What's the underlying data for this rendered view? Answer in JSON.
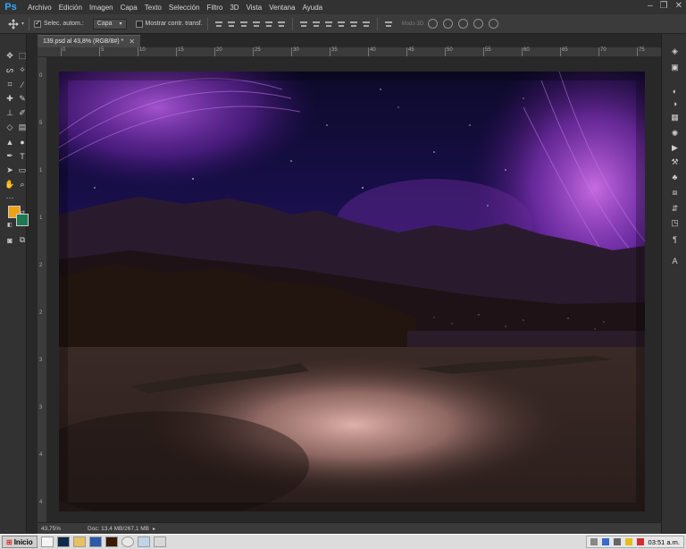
{
  "app": {
    "logo": "Ps"
  },
  "menu": [
    "Archivo",
    "Edición",
    "Imagen",
    "Capa",
    "Texto",
    "Selección",
    "Filtro",
    "3D",
    "Vista",
    "Ventana",
    "Ayuda"
  ],
  "window_controls": [
    "minimize-icon",
    "restore-icon",
    "close-icon"
  ],
  "options_bar": {
    "auto_select_label": "Selec. autom.:",
    "auto_select_checked": true,
    "auto_select_target": "Capa",
    "show_transform_label": "Mostrar contr. transf.",
    "show_transform_checked": false,
    "mode3d_label": "Modo 3D:"
  },
  "document": {
    "tab_title": "139.psd al 43,8% (RGB/8#) *",
    "zoom": "43,75%",
    "doc_size": "Doc: 13,4 MB/267,1 MB"
  },
  "rulers": {
    "top": [
      "0",
      "5",
      "10",
      "15",
      "20",
      "25",
      "30",
      "35",
      "40",
      "45",
      "50",
      "55",
      "60",
      "65",
      "70",
      "75"
    ],
    "left": [
      "0",
      "5",
      "1",
      "1",
      "2",
      "2",
      "3",
      "3",
      "4",
      "4"
    ]
  },
  "colors": {
    "foreground": "#f0a015",
    "background": "#1f7a52",
    "accent": "#31a8ff"
  },
  "taskbar": {
    "start_label": "Inicio",
    "clock": "03:51 a.m.",
    "apps": [
      "brave-icon",
      "photoshop-icon",
      "folder-icon",
      "word-icon",
      "illustrator-icon",
      "chrome-icon",
      "window-icon",
      "window-icon"
    ]
  }
}
